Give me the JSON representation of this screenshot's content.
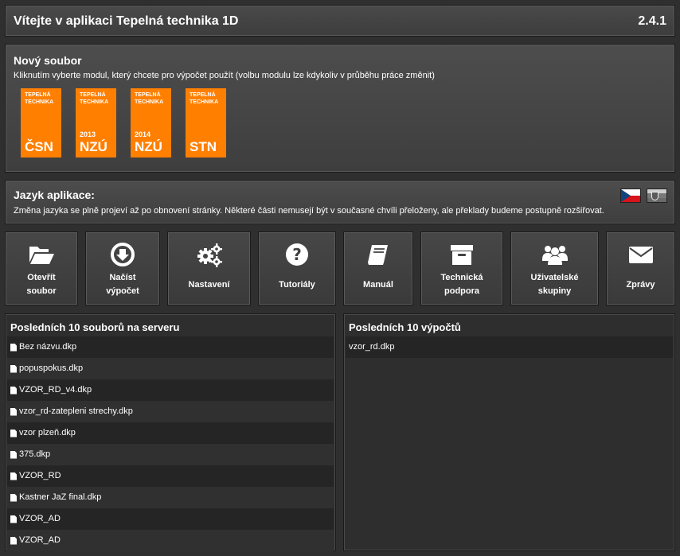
{
  "header": {
    "title": "Vítejte v aplikaci Tepelná technika 1D",
    "version": "2.4.1"
  },
  "new_file": {
    "heading": "Nový soubor",
    "subtitle": "Kliknutím vyberte modul, který chcete pro výpočet použít (volbu modulu lze kdykoliv v průběhu práce změnit)",
    "modules": [
      {
        "brand": "TEPELNÁ TECHNIKA",
        "year": "",
        "code": "ČSN"
      },
      {
        "brand": "TEPELNÁ TECHNIKA",
        "year": "2013",
        "code": "NZÚ"
      },
      {
        "brand": "TEPELNÁ TECHNIKA",
        "year": "2014",
        "code": "NZÚ"
      },
      {
        "brand": "TEPELNÁ TECHNIKA",
        "year": "",
        "code": "STN"
      }
    ],
    "module_color": "#ff7f00"
  },
  "language": {
    "heading": "Jazyk aplikace:",
    "subtitle": "Změna jazyka se plně projeví až po obnovení stránky. Některé části nemusejí být v současné chvíli přeloženy, ale překlady budeme postupně rozšiřovat.",
    "flags": [
      "cz-flag-icon",
      "sk-flag-icon"
    ]
  },
  "tools": [
    {
      "label": "Otevřít\nsoubor",
      "icon": "folder-open-icon"
    },
    {
      "label": "Načíst\nvýpočet",
      "icon": "download-circle-icon"
    },
    {
      "label": "Nastavení",
      "icon": "gears-icon"
    },
    {
      "label": "Tutoriály",
      "icon": "question-circle-icon"
    },
    {
      "label": "Manuál",
      "icon": "book-icon"
    },
    {
      "label": "Technická\npodpora",
      "icon": "archive-box-icon"
    },
    {
      "label": "Uživatelské\nskupiny",
      "icon": "users-icon"
    },
    {
      "label": "Zprávy",
      "icon": "envelope-icon"
    }
  ],
  "recent_files": {
    "heading": "Posledních 10 souborů na serveru",
    "items": [
      "Bez názvu.dkp",
      "popuspokus.dkp",
      "VZOR_RD_v4.dkp",
      "vzor_rd-zatepleni strechy.dkp",
      "vzor plzeň.dkp",
      "375.dkp",
      "VZOR_RD",
      "Kastner JaZ final.dkp",
      "VZOR_AD",
      "VZOR_AD"
    ]
  },
  "recent_calcs": {
    "heading": "Posledních 10 výpočtů",
    "items": [
      "vzor_rd.dkp"
    ]
  }
}
